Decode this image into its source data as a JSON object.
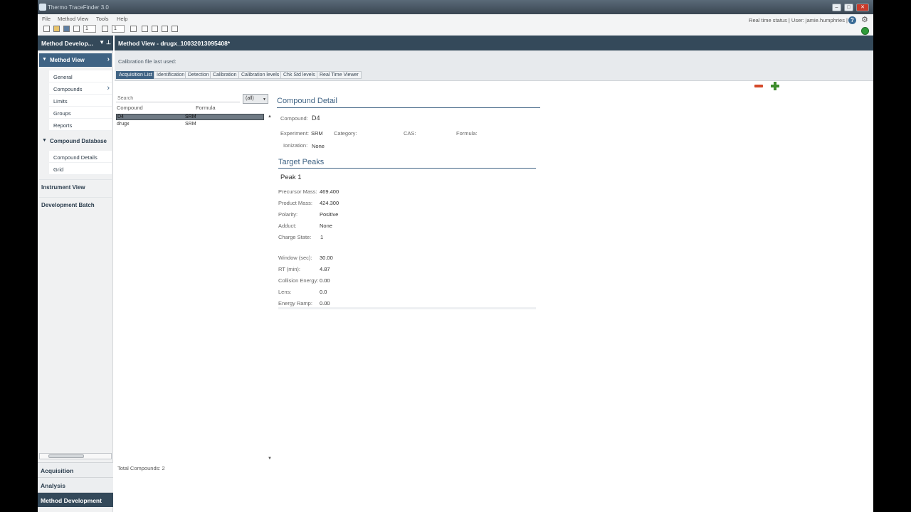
{
  "window": {
    "title": "Thermo TraceFinder 3.0"
  },
  "menu": {
    "items": [
      "File",
      "Method View",
      "Tools",
      "Help"
    ]
  },
  "toolbar": {
    "spin1": "1",
    "spin2": "1"
  },
  "status": {
    "text": "Real time status | User: jamie.humphries |"
  },
  "left_panel": {
    "header": "Method Develop...",
    "method_view": {
      "label": "Method View",
      "items": [
        "General",
        "Compounds",
        "Limits",
        "Groups",
        "Reports"
      ]
    },
    "compound_database": {
      "label": "Compound Database",
      "items": [
        "Compound Details",
        "Grid"
      ]
    },
    "instrument_view": "Instrument View",
    "development_batch": "Development Batch",
    "bottom_nav": [
      "Acquisition",
      "Analysis",
      "Method Development"
    ]
  },
  "main": {
    "title": "Method View - drugx_10032013095408*",
    "calibration_label": "Calibration file last used:",
    "tabs": [
      "Acquisition List",
      "Identification",
      "Detection",
      "Calibration",
      "Calibration levels",
      "Chk Std levels",
      "Real Time Viewer"
    ],
    "active_tab": "Acquisition List"
  },
  "compound_list": {
    "search_placeholder": "Search",
    "filter": "(all)",
    "columns": [
      "Compound",
      "Formula"
    ],
    "rows": [
      {
        "compound": "D4",
        "formula": "SRM"
      },
      {
        "compound": "drugx",
        "formula": "SRM"
      }
    ],
    "total": "Total Compounds: 2"
  },
  "compound_detail": {
    "title": "Compound Detail",
    "compound_label": "Compound:",
    "compound_value": "D4",
    "experiment_label": "Experiment:",
    "experiment_value": "SRM",
    "category_label": "Category:",
    "cas_label": "CAS:",
    "formula_label": "Formula:",
    "ionization_label": "Ionization:",
    "ionization_value": "None"
  },
  "target_peaks": {
    "title": "Target Peaks",
    "peak_name": "Peak 1",
    "fields": [
      {
        "label": "Precursor Mass:",
        "value": "469.400"
      },
      {
        "label": "Product Mass:",
        "value": "424.300"
      },
      {
        "label": "Polarity:",
        "value": "Positive"
      },
      {
        "label": "Adduct:",
        "value": "None"
      },
      {
        "label": "Charge State:",
        "value": "1"
      },
      {
        "label": "Window (sec):",
        "value": "30.00"
      },
      {
        "label": "RT (min):",
        "value": "4.87"
      },
      {
        "label": "Collision Energy:",
        "value": "0.00"
      },
      {
        "label": "Lens:",
        "value": "0.0"
      },
      {
        "label": "Energy Ramp:",
        "value": "0.00"
      }
    ]
  },
  "colors": {
    "header": "#34495a",
    "accent": "#3f6384",
    "remove": "#d44a2a",
    "add": "#3e8c2c"
  }
}
